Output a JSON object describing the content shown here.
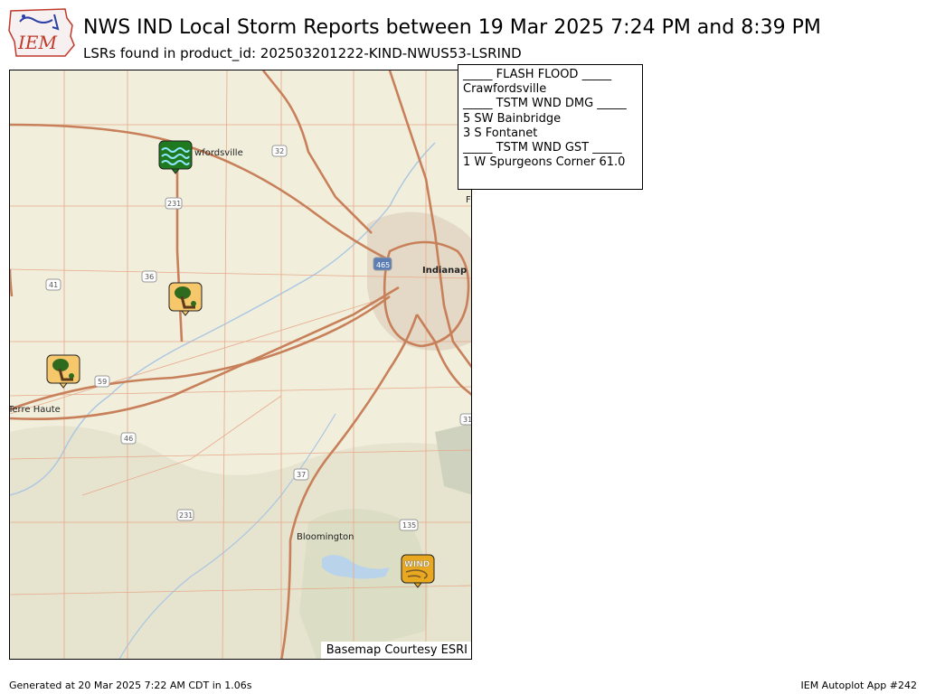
{
  "header": {
    "title": "NWS IND Local Storm Reports between 19 Mar 2025 7:24 PM and 8:39 PM",
    "subtitle": "LSRs found in product_id: 202503201222-KIND-NWUS53-LSRIND",
    "logo_text": "IEM"
  },
  "map": {
    "credit": "Basemap Courtesy ESRI",
    "places": {
      "crawfordsville": "wfordsville",
      "indianapolis": "Indianap",
      "terre_haute": "Terre Haute",
      "bloomington": "Bloomington",
      "f_edge": "F"
    },
    "shields": {
      "s32": "32",
      "s231a": "231",
      "s36": "36",
      "s41": "41",
      "s465": "465",
      "s59": "59",
      "s46": "46",
      "s37": "37",
      "s231b": "231",
      "s135": "135",
      "s31": "31"
    },
    "markers": [
      {
        "type": "flash-flood",
        "label": "Crawfordsville",
        "color": "#1f7a1f"
      },
      {
        "type": "tstm-wnd-dmg",
        "label": "5 SW Bainbridge",
        "color": "#f6c86b"
      },
      {
        "type": "tstm-wnd-dmg",
        "label": "3 S Fontanet",
        "color": "#f6c86b"
      },
      {
        "type": "tstm-wnd-gst",
        "label": "1 W Spurgeons Corner",
        "text": "WIND",
        "color": "#e8a820"
      }
    ]
  },
  "legend": {
    "flash_flood_header": "_____ FLASH FLOOD _____",
    "flash_flood_1": "Crawfordsville",
    "wnd_dmg_header": "_____ TSTM WND DMG _____",
    "wnd_dmg_1": "5 SW Bainbridge",
    "wnd_dmg_2": "3 S Fontanet",
    "wnd_gst_header": "_____ TSTM WND GST _____",
    "wnd_gst_1": "1 W Spurgeons Corner 61.0"
  },
  "footer": {
    "generated": "Generated at 20 Mar 2025 7:22 AM CDT in 1.06s",
    "app": "IEM Autoplot App #242"
  }
}
